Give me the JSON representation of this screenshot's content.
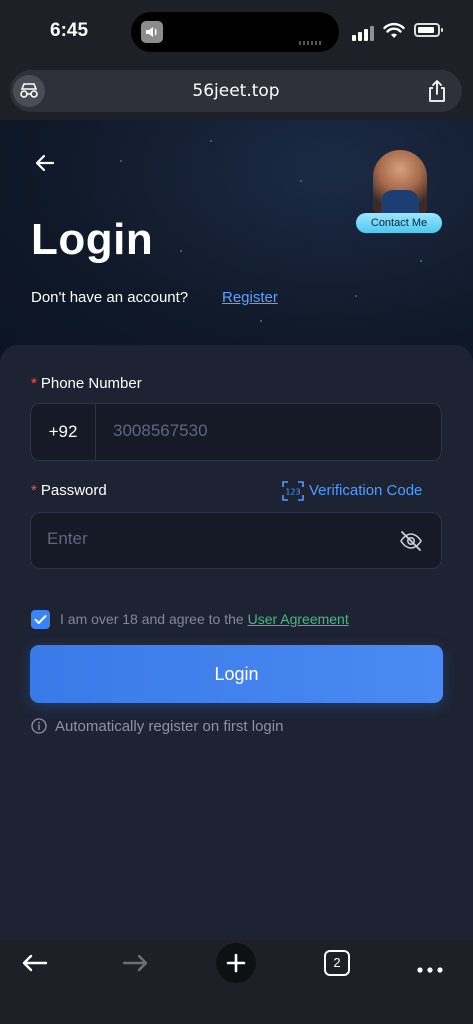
{
  "status_bar": {
    "time": "6:45"
  },
  "browser": {
    "url": "56jeet.top",
    "tab_count": "2"
  },
  "header": {
    "title": "Login",
    "no_account_text": "Don't have an account?",
    "register_link": "Register",
    "contact_button": "Contact Me"
  },
  "form": {
    "required_mark": "*",
    "phone_label": "Phone Number",
    "phone_prefix": "+92",
    "phone_value": "3008567530",
    "password_label": "Password",
    "verification_code_link": "Verification Code",
    "verification_icon_text": "123",
    "password_placeholder": "Enter",
    "agreement_text": "I am over 18 and agree to the",
    "agreement_link": "User Agreement",
    "agreement_checked": true,
    "login_button": "Login",
    "auto_register_note": "Automatically register on first login"
  },
  "colors": {
    "accent": "#3b82f6",
    "link_blue": "#5aa2ff",
    "agreement_green": "#3fbf7f",
    "required_red": "#ff4d4f",
    "background": "#1d2131"
  },
  "icons": [
    "reader-mode-icon",
    "share-icon",
    "back-arrow-icon",
    "verification-code-icon",
    "eye-slash-icon",
    "checkbox-check-icon",
    "info-icon",
    "browser-back-icon",
    "browser-forward-icon",
    "plus-icon",
    "tabs-icon",
    "more-icon"
  ]
}
